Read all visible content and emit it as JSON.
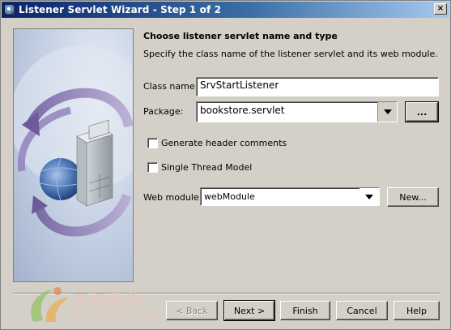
{
  "window": {
    "title": "Listener Servlet Wizard - Step 1 of 2",
    "close_label": "×"
  },
  "panel": {
    "heading": "Choose listener servlet name and type",
    "description": "Specify the class name of the listener servlet and its web module."
  },
  "form": {
    "class_name_label": "Class name:",
    "class_name_value": "SrvStartListener",
    "package_label": "Package:",
    "package_value": "bookstore.servlet",
    "browse_label": "...",
    "generate_header_label": "Generate header comments",
    "generate_header_checked": false,
    "single_thread_label": "Single Thread Model",
    "single_thread_checked": false,
    "web_module_label": "Web module:",
    "web_module_value": "webModule",
    "new_label": "New..."
  },
  "buttons": {
    "back": "< Back",
    "next": "Next >",
    "finish": "Finish",
    "cancel": "Cancel",
    "help": "Help"
  },
  "watermark": {
    "cn_text": "天极软件",
    "url_text": "Soft.yesky.com"
  },
  "colors": {
    "titlebar_start": "#0a246a",
    "titlebar_end": "#a6caf0",
    "dialog_bg": "#d4d0c8"
  }
}
